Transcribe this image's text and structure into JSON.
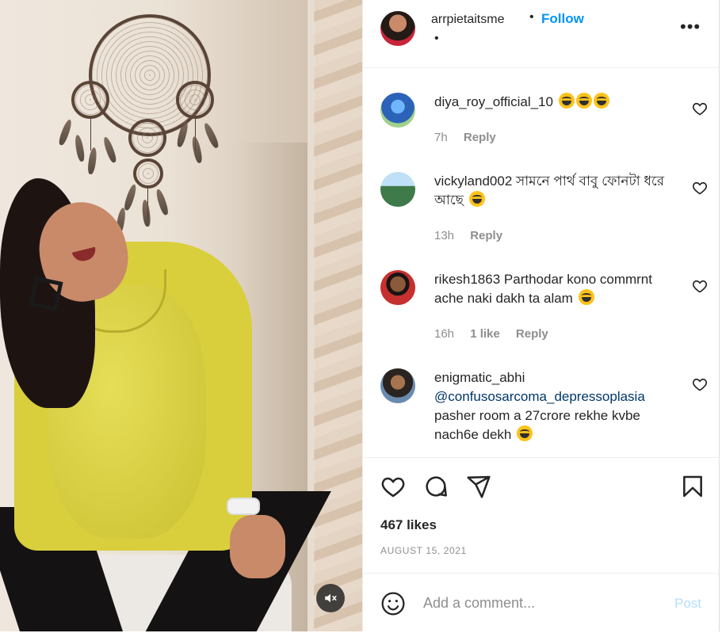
{
  "post": {
    "username": "arrpietaitsme",
    "follow_label": "Follow",
    "separator": "•",
    "sub_separator": "•",
    "more_label": "•••",
    "likes": "467 likes",
    "date": "AUGUST 15, 2021"
  },
  "comments": [
    {
      "username": "diya_roy_official_10",
      "text": "",
      "emoji_count": 3,
      "time": "7h",
      "likes": "",
      "reply_label": "Reply",
      "avatar_color": "#3a7bd5"
    },
    {
      "username": "vickyland002",
      "text": "সামনে পার্থ বাবু ফোনটা ধরে আছে",
      "emoji_count": 1,
      "time": "13h",
      "likes": "",
      "reply_label": "Reply",
      "avatar_color": "#4f8a5b"
    },
    {
      "username": "rikesh1863",
      "text": "Parthodar kono commrnt ache naki dakh ta alam",
      "emoji_count": 1,
      "time": "16h",
      "likes": "1 like",
      "reply_label": "Reply",
      "avatar_color": "#b83a3a"
    },
    {
      "username": "enigmatic_abhi",
      "mention": "@confusosarcoma_depressoplasia",
      "text": "pasher room a 27crore rekhe kvbe nach6e dekh",
      "emoji_count": 1,
      "time": "",
      "likes": "",
      "reply_label": "",
      "avatar_color": "#5a4a3a"
    }
  ],
  "composer": {
    "placeholder": "Add a comment...",
    "post_label": "Post"
  },
  "colors": {
    "accent": "#0095f6",
    "post_disabled": "#b2dffc",
    "muted": "#8e8e8e"
  },
  "icons": [
    "mute-icon",
    "heart-icon",
    "comment-icon",
    "share-icon",
    "bookmark-icon",
    "emoji-icon",
    "more-icon"
  ]
}
